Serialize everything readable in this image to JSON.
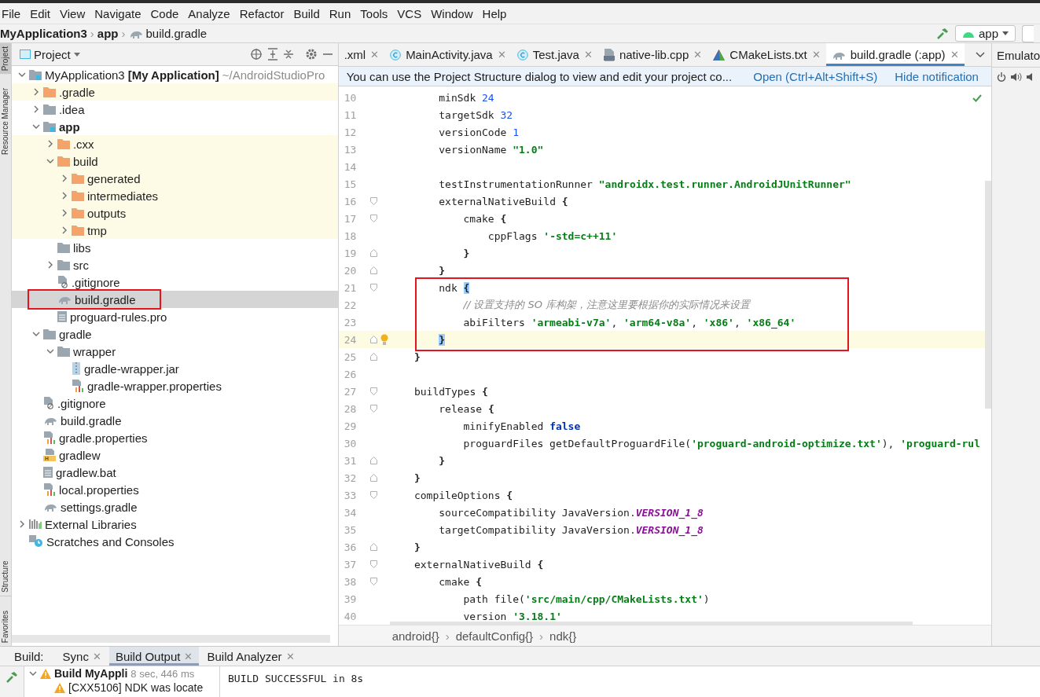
{
  "menu": [
    "File",
    "Edit",
    "View",
    "Navigate",
    "Code",
    "Analyze",
    "Refactor",
    "Build",
    "Run",
    "Tools",
    "VCS",
    "Window",
    "Help"
  ],
  "navbar": {
    "crumbs": [
      {
        "label": "MyApplication3"
      },
      {
        "sep": "›",
        "label": "app"
      },
      {
        "sep": "›",
        "label": "build.gradle",
        "kind": "gradle"
      }
    ],
    "run_config": "app"
  },
  "project": {
    "title": "Project",
    "tree": [
      {
        "label": "MyApplication3",
        "module": "[My Application]",
        "path": "~/AndroidStudioPro",
        "kind": "module",
        "expanded": true,
        "children": [
          {
            "label": ".gradle",
            "kind": "folder-excluded",
            "expanded": false,
            "excluded": true
          },
          {
            "label": ".idea",
            "kind": "folder",
            "expanded": false
          },
          {
            "label": "app",
            "kind": "module",
            "expanded": true,
            "bold": true,
            "children": [
              {
                "label": ".cxx",
                "kind": "folder-excluded",
                "expanded": false,
                "excluded": true
              },
              {
                "label": "build",
                "kind": "folder-excluded",
                "expanded": true,
                "excluded": true,
                "children": [
                  {
                    "label": "generated",
                    "kind": "folder-excluded",
                    "expanded": false,
                    "excluded": true
                  },
                  {
                    "label": "intermediates",
                    "kind": "folder-excluded",
                    "expanded": false,
                    "excluded": true
                  },
                  {
                    "label": "outputs",
                    "kind": "folder-excluded",
                    "expanded": false,
                    "excluded": true
                  },
                  {
                    "label": "tmp",
                    "kind": "folder-excluded",
                    "expanded": false,
                    "excluded": true
                  }
                ]
              },
              {
                "label": "libs",
                "kind": "folder"
              },
              {
                "label": "src",
                "kind": "folder",
                "expanded": false
              },
              {
                "label": ".gitignore",
                "kind": "ignore"
              },
              {
                "label": "build.gradle",
                "kind": "gradle",
                "selected": true,
                "annotated": true
              },
              {
                "label": "proguard-rules.pro",
                "kind": "text"
              }
            ]
          },
          {
            "label": "gradle",
            "kind": "folder",
            "expanded": true,
            "children": [
              {
                "label": "wrapper",
                "kind": "folder",
                "expanded": true,
                "children": [
                  {
                    "label": "gradle-wrapper.jar",
                    "kind": "jar"
                  },
                  {
                    "label": "gradle-wrapper.properties",
                    "kind": "properties"
                  }
                ]
              }
            ]
          },
          {
            "label": ".gitignore",
            "kind": "ignore"
          },
          {
            "label": "build.gradle",
            "kind": "gradle"
          },
          {
            "label": "gradle.properties",
            "kind": "properties"
          },
          {
            "label": "gradlew",
            "kind": "shell"
          },
          {
            "label": "gradlew.bat",
            "kind": "text"
          },
          {
            "label": "local.properties",
            "kind": "properties"
          },
          {
            "label": "settings.gradle",
            "kind": "gradle"
          }
        ]
      },
      {
        "label": "External Libraries",
        "kind": "libraries",
        "expanded": false
      },
      {
        "label": "Scratches and Consoles",
        "kind": "scratches"
      }
    ]
  },
  "side_tabs": [
    "Project",
    "Resource Manager",
    "Structure",
    "Favorites"
  ],
  "editor": {
    "tabs": [
      {
        "label": ".xml",
        "close": "✕",
        "selected": false
      },
      {
        "label": "MainActivity.java",
        "kind": "class",
        "close": "✕",
        "selected": false
      },
      {
        "label": "Test.java",
        "kind": "class",
        "close": "✕",
        "selected": false
      },
      {
        "label": "native-lib.cpp",
        "kind": "cpp",
        "close": "✕",
        "selected": false
      },
      {
        "label": "CMakeLists.txt",
        "kind": "cmake",
        "close": "✕",
        "selected": false
      },
      {
        "label": "build.gradle (:app)",
        "kind": "gradle",
        "close": "✕",
        "selected": true
      }
    ],
    "notification": {
      "text": "You can use the Project Structure dialog to view and edit your project co...",
      "links": [
        "Open (Ctrl+Alt+Shift+S)",
        "Hide notification"
      ]
    },
    "lines": [
      {
        "n": "10",
        "tokens": [
          {
            "kind": "plain",
            "text": "        minSdk "
          },
          {
            "kind": "number",
            "text": "24"
          }
        ]
      },
      {
        "n": "11",
        "tokens": [
          {
            "kind": "plain",
            "text": "        targetSdk "
          },
          {
            "kind": "number",
            "text": "32"
          }
        ]
      },
      {
        "n": "12",
        "tokens": [
          {
            "kind": "plain",
            "text": "        versionCode "
          },
          {
            "kind": "number",
            "text": "1"
          }
        ]
      },
      {
        "n": "13",
        "tokens": [
          {
            "kind": "plain",
            "text": "        versionName "
          },
          {
            "kind": "string",
            "text": "\"1.0\""
          }
        ]
      },
      {
        "n": "14"
      },
      {
        "n": "15",
        "tokens": [
          {
            "kind": "plain",
            "text": "        testInstrumentationRunner "
          },
          {
            "kind": "string",
            "text": "\"androidx.test.runner.AndroidJUnitRunner\""
          }
        ]
      },
      {
        "n": "16",
        "kind": "fold-start",
        "tokens": [
          {
            "kind": "plain",
            "text": "        externalNativeBuild "
          },
          {
            "kind": "brace",
            "text": "{"
          }
        ]
      },
      {
        "n": "17",
        "kind": "fold-start",
        "tokens": [
          {
            "kind": "plain",
            "text": "            cmake "
          },
          {
            "kind": "brace",
            "text": "{"
          }
        ]
      },
      {
        "n": "18",
        "tokens": [
          {
            "kind": "plain",
            "text": "                cppFlags "
          },
          {
            "kind": "string",
            "text": "'-std=c++11'"
          }
        ]
      },
      {
        "n": "19",
        "kind": "fold-end",
        "tokens": [
          {
            "kind": "brace",
            "text": "            }"
          }
        ]
      },
      {
        "n": "20",
        "kind": "fold-end",
        "tokens": [
          {
            "kind": "brace",
            "text": "        }"
          }
        ]
      },
      {
        "n": "21",
        "kind": "fold-start",
        "annotated": true,
        "tokens": [
          {
            "kind": "plain",
            "text": "        ndk "
          },
          {
            "kind": "brace-match",
            "text": "{"
          }
        ]
      },
      {
        "n": "22",
        "annotated": true,
        "tokens": [
          {
            "kind": "comment",
            "text": "            // 设置支持的 SO 库构架，注意这里要根据你的实际情况来设置"
          }
        ]
      },
      {
        "n": "23",
        "annotated": true,
        "tokens": [
          {
            "kind": "plain",
            "text": "            abiFilters "
          },
          {
            "kind": "string",
            "text": "'armeabi-v7a'"
          },
          {
            "kind": "plain",
            "text": ", "
          },
          {
            "kind": "string",
            "text": "'arm64-v8a'"
          },
          {
            "kind": "plain",
            "text": ", "
          },
          {
            "kind": "string",
            "text": "'x86'"
          },
          {
            "kind": "plain",
            "text": ", "
          },
          {
            "kind": "string",
            "text": "'x86_64'"
          }
        ]
      },
      {
        "n": "24",
        "kind": "fold-end",
        "annotated": true,
        "current": true,
        "tokens": [
          {
            "kind": "brace-match",
            "text": "        }"
          }
        ]
      },
      {
        "n": "25",
        "kind": "fold-end",
        "tokens": [
          {
            "kind": "brace",
            "text": "    }"
          }
        ]
      },
      {
        "n": "26"
      },
      {
        "n": "27",
        "kind": "fold-start",
        "tokens": [
          {
            "kind": "plain",
            "text": "    buildTypes "
          },
          {
            "kind": "brace",
            "text": "{"
          }
        ]
      },
      {
        "n": "28",
        "kind": "fold-start",
        "tokens": [
          {
            "kind": "plain",
            "text": "        release "
          },
          {
            "kind": "brace",
            "text": "{"
          }
        ]
      },
      {
        "n": "29",
        "tokens": [
          {
            "kind": "plain",
            "text": "            minifyEnabled "
          },
          {
            "kind": "keyword",
            "text": "false"
          }
        ]
      },
      {
        "n": "30",
        "tokens": [
          {
            "kind": "plain",
            "text": "            proguardFiles getDefaultProguardFile("
          },
          {
            "kind": "string",
            "text": "'proguard-android-optimize.txt'"
          },
          {
            "kind": "plain",
            "text": "), "
          },
          {
            "kind": "string",
            "text": "'proguard-rul"
          }
        ]
      },
      {
        "n": "31",
        "kind": "fold-end",
        "tokens": [
          {
            "kind": "brace",
            "text": "        }"
          }
        ]
      },
      {
        "n": "32",
        "kind": "fold-end",
        "tokens": [
          {
            "kind": "brace",
            "text": "    }"
          }
        ]
      },
      {
        "n": "33",
        "kind": "fold-start",
        "tokens": [
          {
            "kind": "plain",
            "text": "    compileOptions "
          },
          {
            "kind": "brace",
            "text": "{"
          }
        ]
      },
      {
        "n": "34",
        "tokens": [
          {
            "kind": "plain",
            "text": "        sourceCompatibility JavaVersion."
          },
          {
            "kind": "constant",
            "text": "VERSION_1_8"
          }
        ]
      },
      {
        "n": "35",
        "tokens": [
          {
            "kind": "plain",
            "text": "        targetCompatibility JavaVersion."
          },
          {
            "kind": "constant",
            "text": "VERSION_1_8"
          }
        ]
      },
      {
        "n": "36",
        "kind": "fold-end",
        "tokens": [
          {
            "kind": "brace",
            "text": "    }"
          }
        ]
      },
      {
        "n": "37",
        "kind": "fold-start",
        "tokens": [
          {
            "kind": "plain",
            "text": "    externalNativeBuild "
          },
          {
            "kind": "brace",
            "text": "{"
          }
        ]
      },
      {
        "n": "38",
        "kind": "fold-start",
        "tokens": [
          {
            "kind": "plain",
            "text": "        cmake "
          },
          {
            "kind": "brace",
            "text": "{"
          }
        ]
      },
      {
        "n": "39",
        "tokens": [
          {
            "kind": "plain",
            "text": "            path file("
          },
          {
            "kind": "string",
            "text": "'src/main/cpp/CMakeLists.txt'"
          },
          {
            "kind": "plain",
            "text": ")"
          }
        ]
      },
      {
        "n": "40",
        "tokens": [
          {
            "kind": "plain",
            "text": "            version "
          },
          {
            "kind": "string",
            "text": "'3.18.1'"
          }
        ]
      }
    ],
    "breadcrumbs": [
      {
        "label": "android{}"
      },
      {
        "sep": "›",
        "label": "defaultConfig{}"
      },
      {
        "sep": "›",
        "label": "ndk{}"
      }
    ]
  },
  "right_panel": {
    "title": "Emulato"
  },
  "build": {
    "label": "Build:",
    "tabs": [
      {
        "label": "Sync",
        "close": "✕",
        "selected": false
      },
      {
        "label": "Build Output",
        "close": "✕",
        "selected": true
      },
      {
        "label": "Build Analyzer",
        "close": "✕",
        "selected": false
      }
    ],
    "tree": [
      {
        "label": "Build MyAppli",
        "time": "8 sec, 446 ms",
        "kind": "warning",
        "expanded": true,
        "children": [
          {
            "label": "[CXX5106] NDK was locate",
            "kind": "warning"
          }
        ]
      }
    ],
    "console": [
      "BUILD SUCCESSFUL in 8s"
    ]
  }
}
